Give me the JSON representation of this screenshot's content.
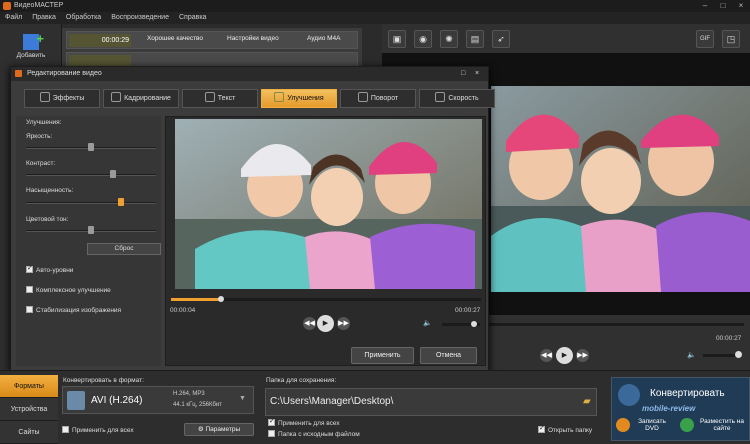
{
  "app": {
    "title": "ВидеоМАСТЕР"
  },
  "window_controls": [
    "–",
    "□",
    "×"
  ],
  "menu": [
    "Файл",
    "Правка",
    "Обработка",
    "Воспроизведение",
    "Справка"
  ],
  "left": {
    "add_label": "Добавить"
  },
  "files": [
    {
      "duration": "00:00:29",
      "quality": "Хорошее качество",
      "settings": "Настройки видео",
      "audio": "Аудио M4A"
    },
    {
      "duration": "00:00:27",
      "quality": "",
      "settings": "",
      "audio": ""
    }
  ],
  "right_toolbar": {
    "icons": [
      "crop-icon",
      "rotate-icon",
      "brightness-icon",
      "film-icon",
      "runner-icon"
    ],
    "gif_label": "GIF",
    "crop_label": "◳"
  },
  "right_player": {
    "time_end": "00:00:27"
  },
  "dialog": {
    "title": "Редактирование видео",
    "tabs": [
      {
        "label": "Эффекты",
        "active": false
      },
      {
        "label": "Кадрирование",
        "active": false
      },
      {
        "label": "Текст",
        "active": false
      },
      {
        "label": "Улучшения",
        "active": true
      },
      {
        "label": "Поворот",
        "active": false
      },
      {
        "label": "Скорость",
        "active": false
      }
    ],
    "enhance": {
      "heading": "Улучшения:",
      "brightness_label": "Яркость:",
      "brightness_value": 0.5,
      "contrast_label": "Контраст:",
      "contrast_value": 0.68,
      "saturation_label": "Насыщенность:",
      "saturation_value": 0.74,
      "hue_label": "Цветовой тон:",
      "hue_value": 0.5,
      "reset_label": "Сброс",
      "auto_levels_label": "Авто-уровни",
      "auto_levels_checked": true,
      "complex_label": "Комплексное улучшение",
      "complex_checked": false,
      "stabilize_label": "Стабилизация изображения",
      "stabilize_checked": false
    },
    "player": {
      "time_current": "00:00:04",
      "time_total": "00:00:27",
      "progress": 0.16,
      "volume": 0.9
    },
    "apply_label": "Применить",
    "cancel_label": "Отмена"
  },
  "bottom": {
    "nav": [
      "Форматы",
      "Устройства",
      "Сайты"
    ],
    "convert_to_label": "Конвертировать в формат:",
    "format_name": "AVI (H.264)",
    "format_line1": "H.264, MP3",
    "format_line2": "44.1 кГц, 256Кбит",
    "apply_all_label": "Применить для всех",
    "params_label": "Параметры",
    "save_folder_label": "Папка для сохранения:",
    "save_path": "C:\\Users\\Manager\\Desktop\\",
    "apply_all_save_label": "Применить для всех",
    "source_folder_label": "Папка с исходным файлом",
    "open_folder_label": "Открыть папку",
    "convert_label": "Конвертировать",
    "burn_label": "Записать DVD",
    "upload_label": "Разместить на сайте",
    "watermark": "mobile-review"
  }
}
